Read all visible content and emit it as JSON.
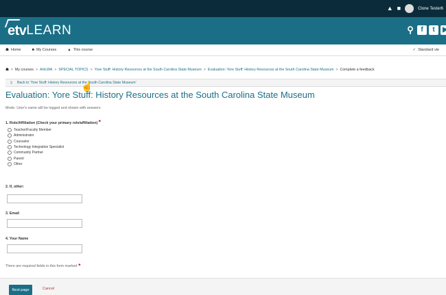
{
  "topbar": {
    "notification_icon": "bell-icon",
    "message_icon": "chat-icon",
    "user_name": "Clone Tester6"
  },
  "brand": {
    "etv": "etv",
    "learn": "LEARN",
    "search_icon": "search-icon",
    "social_icons": [
      "facebook-icon",
      "twitter-icon",
      "youtube-icon"
    ]
  },
  "nav": {
    "home": "Home",
    "my_courses": "My Courses",
    "this_course": "This course",
    "standard_view": "Standard vie"
  },
  "breadcrumb": [
    {
      "label": "My courses",
      "link": false
    },
    {
      "label": "AHLWA",
      "link": true
    },
    {
      "label": "SPECIAL TOPICS",
      "link": true
    },
    {
      "label": "Yore Stuff: History Resources at the South Carolina State Museum",
      "link": true
    },
    {
      "label": "Evaluation: Yore Stuff: History Resources at the South Carolina State Museum",
      "link": true
    },
    {
      "label": "Complete a feedback",
      "link": false
    }
  ],
  "back_link": "Back to 'Yore Stuff: History Resources at the South Carolina State Museum'",
  "page_title": "Evaluation: Yore Stuff: History Resources at the South Carolina State Museum",
  "mode_text": "Mode: User's name will be logged and shown with answers",
  "questions": {
    "q1": {
      "label": "1. Role/Affiliation (Check your primary role/affiliation)",
      "options": [
        "Teacher/Faculty Member",
        "Administrator",
        "Counselor",
        "Technology Integration Specialist",
        "Community Partner",
        "Parent",
        "Other"
      ]
    },
    "q2": {
      "label": "2. If, other:",
      "value": ""
    },
    "q3": {
      "label": "3. Email",
      "value": ""
    },
    "q4": {
      "label": "4. Your Name",
      "value": ""
    }
  },
  "required_notice": "There are required fields in this form marked",
  "actions": {
    "next": "Next page",
    "cancel": "Cancel"
  },
  "colors": {
    "topbar": "#0b2b3a",
    "banner": "#1a6f86",
    "accent": "#1a6f86",
    "required": "#c00000"
  }
}
